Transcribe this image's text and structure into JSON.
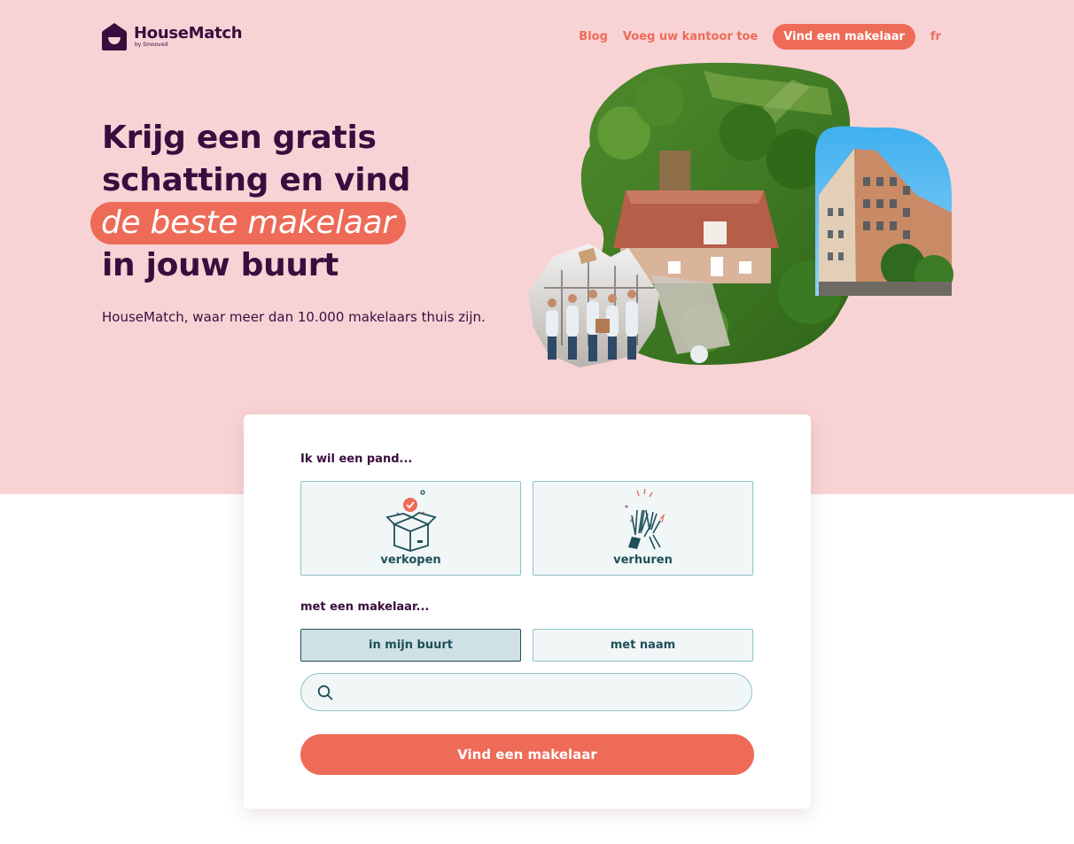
{
  "brand": {
    "name": "HouseMatch",
    "sub": "by Smooved"
  },
  "nav": {
    "blog": "Blog",
    "add_office": "Voeg uw kantoor toe",
    "find_agent": "Vind een makelaar",
    "language": "fr"
  },
  "hero": {
    "line1": "Krijg een gratis",
    "line2": "schatting en vind",
    "highlight": "de beste makelaar",
    "line4": "in jouw buurt",
    "tagline": "HouseMatch, waar meer dan 10.000 makelaars thuis zijn."
  },
  "form": {
    "label_property": "Ik wil een pand...",
    "options": [
      {
        "label": "verkopen",
        "icon": "open-box-icon"
      },
      {
        "label": "verhuren",
        "icon": "high-five-icon"
      }
    ],
    "label_agent": "met een makelaar...",
    "toggle_near": "in mijn buurt",
    "toggle_name": "met naam",
    "search_value": "",
    "submit": "Vind een makelaar"
  },
  "colors": {
    "hero_bg": "#f8d3d5",
    "accent": "#ee6b58",
    "brand_dark": "#3a0d3f",
    "teal": "#1e5058"
  }
}
